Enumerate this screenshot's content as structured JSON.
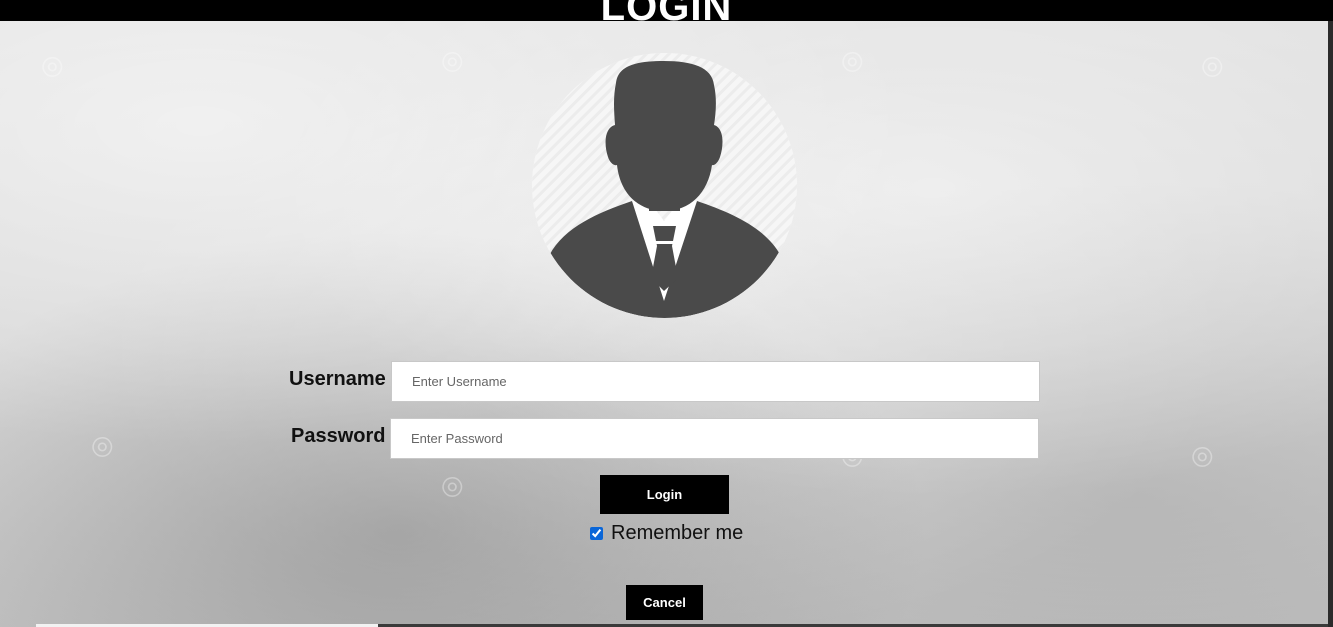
{
  "header": {
    "title": "LOGIN"
  },
  "avatar": {
    "icon": "user-avatar-icon",
    "circle_color": "#f5f5f5",
    "figure_color": "#4a4a4a"
  },
  "form": {
    "username": {
      "label": "Username",
      "placeholder": "Enter Username",
      "value": ""
    },
    "password": {
      "label": "Password",
      "placeholder": "Enter Password",
      "value": ""
    },
    "login_button": "Login",
    "remember_me": {
      "label": "Remember me",
      "checked": true
    },
    "cancel_button": "Cancel"
  },
  "colors": {
    "button_bg": "#000000",
    "button_text": "#ffffff",
    "checkbox_accent": "#0a66d8"
  }
}
